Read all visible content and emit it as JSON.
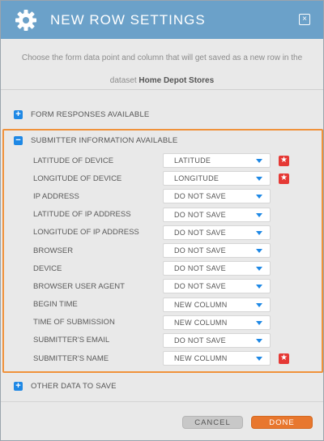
{
  "dialog": {
    "title": "NEW ROW SETTINGS",
    "close_label": "×",
    "description_prefix": "Choose the form data point and column that will get saved as a new row in the",
    "description_mid": "dataset",
    "dataset_name": "Home Depot Stores"
  },
  "sections": {
    "form_responses": {
      "label": "FORM RESPONSES AVAILABLE",
      "toggle": "+"
    },
    "submitter": {
      "label": "SUBMITTER INFORMATION AVAILABLE",
      "toggle": "−"
    },
    "other": {
      "label": "OTHER DATA TO SAVE",
      "toggle": "+"
    }
  },
  "rows": [
    {
      "label": "LATITUDE OF DEVICE",
      "value": "LATITUDE",
      "required": true
    },
    {
      "label": "LONGITUDE OF DEVICE",
      "value": "LONGITUDE",
      "required": true
    },
    {
      "label": "IP ADDRESS",
      "value": "DO NOT SAVE",
      "required": false
    },
    {
      "label": "LATITUDE OF IP ADDRESS",
      "value": "DO NOT SAVE",
      "required": false
    },
    {
      "label": "LONGITUDE OF IP ADDRESS",
      "value": "DO NOT SAVE",
      "required": false
    },
    {
      "label": "BROWSER",
      "value": "DO NOT SAVE",
      "required": false
    },
    {
      "label": "DEVICE",
      "value": "DO NOT SAVE",
      "required": false
    },
    {
      "label": "BROWSER USER AGENT",
      "value": "DO NOT SAVE",
      "required": false
    },
    {
      "label": "BEGIN TIME",
      "value": "NEW COLUMN",
      "required": false
    },
    {
      "label": "TIME OF SUBMISSION",
      "value": "NEW COLUMN",
      "required": false
    },
    {
      "label": "SUBMITTER'S EMAIL",
      "value": "DO NOT SAVE",
      "required": false
    },
    {
      "label": "SUBMITTER'S NAME",
      "value": "NEW COLUMN",
      "required": true
    }
  ],
  "star_glyph": "★",
  "footer": {
    "cancel_label": "CANCEL",
    "done_label": "DONE"
  },
  "colors": {
    "header": "#6ba1c9",
    "accent_blue": "#1e88e5",
    "highlight_orange": "#f0923b",
    "done_button": "#e8772e",
    "required_star": "#e53935"
  },
  "icons": {
    "header": "gear-icon",
    "close": "close-icon",
    "dropdown": "caret-down-icon",
    "required": "star-icon"
  }
}
